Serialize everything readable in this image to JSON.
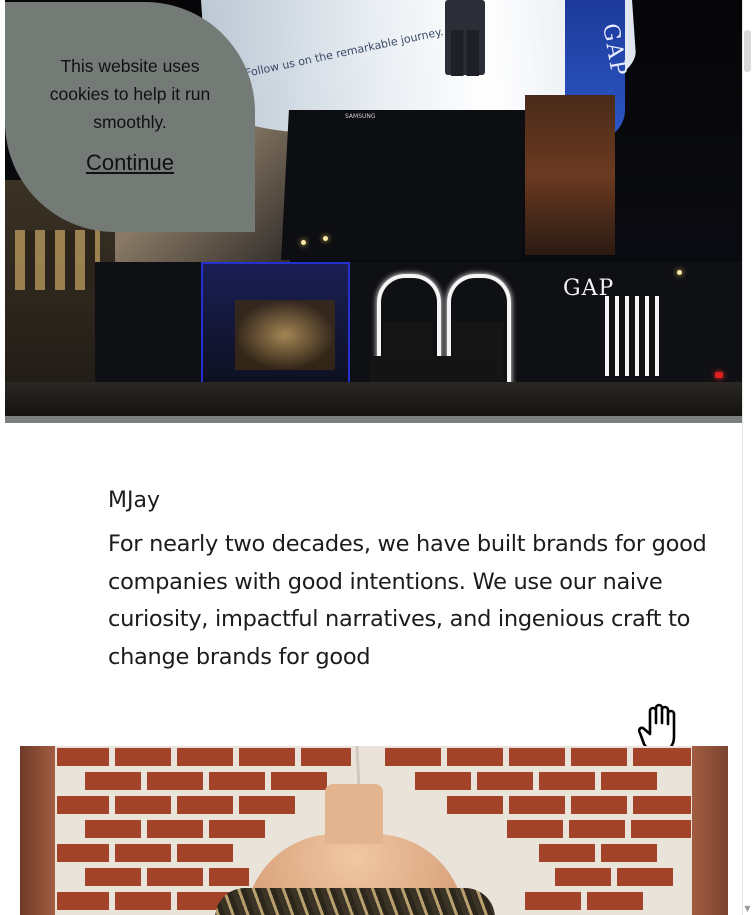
{
  "cookie_banner": {
    "message": "This website uses cookies to help it run smoothly.",
    "continue_label": "Continue"
  },
  "hero": {
    "billboard_text": "GAP",
    "store_sign": "GAP",
    "screen_brand": "SAMSUNG",
    "screen_text": "Follow us on the remarkable journey."
  },
  "content": {
    "brand_name": "MJay",
    "description": "For nearly two decades, we have built brands for good companies with good intentions. We use our naive curiosity, impactful narratives, and ingenious craft to change brands for good"
  },
  "icons": {
    "cursor": "hand-grab-cursor-icon"
  }
}
